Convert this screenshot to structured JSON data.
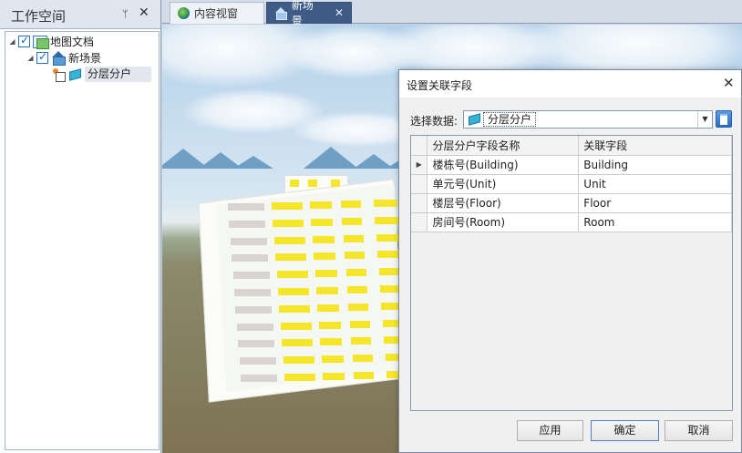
{
  "workspace": {
    "title": "工作空间",
    "pin_glyph": "ᛘ",
    "close_glyph": "✕",
    "tree": {
      "map_docs": "地图文档",
      "scene": "新场景",
      "layer": "分层分户"
    }
  },
  "tabs": [
    {
      "label": "内容视窗",
      "icon": "globe-icon"
    },
    {
      "label": "新场景",
      "icon": "scene-icon",
      "close_glyph": "✕"
    }
  ],
  "dialog": {
    "title": "设置关联字段",
    "close_glyph": "✕",
    "select_label": "选择数据:",
    "selected_data": "分层分户",
    "columns": [
      "分层分户字段名称",
      "关联字段"
    ],
    "rows": [
      {
        "field": "楼栋号(Building)",
        "link": "Building"
      },
      {
        "field": "单元号(Unit)",
        "link": "Unit"
      },
      {
        "field": "楼层号(Floor)",
        "link": "Floor"
      },
      {
        "field": "房间号(Room)",
        "link": "Room"
      }
    ],
    "buttons": {
      "apply": "应用",
      "ok": "确定",
      "cancel": "取消"
    }
  },
  "colors": {
    "active_tab": "#3f5c86",
    "window_yellow": "#f6e62a",
    "building_white": "#fbfbf8"
  }
}
